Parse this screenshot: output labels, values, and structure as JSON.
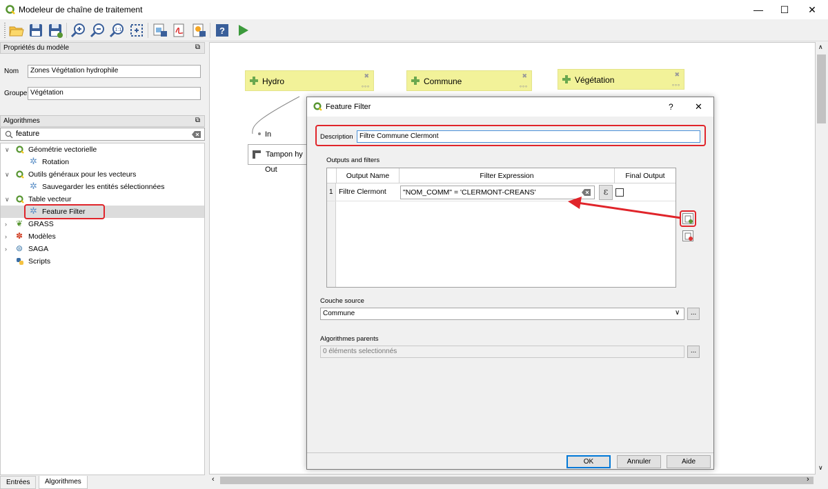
{
  "window": {
    "title": "Modeleur de chaîne de traitement",
    "minimize": "—",
    "maximize": "☐",
    "close": "✕"
  },
  "toolbar": {
    "icons": [
      "open-model-icon",
      "save-model-icon",
      "save-as-icon",
      "zoom-in-icon",
      "zoom-out-icon",
      "zoom-actual-icon",
      "zoom-full-icon",
      "export-image-icon",
      "export-pdf-icon",
      "export-svg-icon",
      "help-icon",
      "run-model-icon"
    ]
  },
  "properties": {
    "header": "Propriétés du modèle",
    "name_label": "Nom",
    "name_value": "Zones Végétation hydrophile",
    "group_label": "Groupe",
    "group_value": "Végétation"
  },
  "algorithms": {
    "header": "Algorithmes",
    "search_value": "feature",
    "tree": [
      {
        "label": "Géométrie vectorielle",
        "level": 0,
        "expanded": true
      },
      {
        "label": "Rotation",
        "level": 1
      },
      {
        "label": "Outils généraux pour les vecteurs",
        "level": 0,
        "expanded": true
      },
      {
        "label": "Sauvegarder les entités sélectionnées",
        "level": 1
      },
      {
        "label": "Table vecteur",
        "level": 0,
        "expanded": true
      },
      {
        "label": "Feature Filter",
        "level": 1,
        "selected": true
      },
      {
        "label": "GRASS",
        "level": 0
      },
      {
        "label": "Modèles",
        "level": 0
      },
      {
        "label": "SAGA",
        "level": 0
      },
      {
        "label": "Scripts",
        "level": 0
      }
    ]
  },
  "bottom_tabs": {
    "inputs": "Entrées",
    "algorithms": "Algorithmes"
  },
  "canvas": {
    "nodes": {
      "hydro": "Hydro",
      "commune": "Commune",
      "vegetation": "Végétation",
      "tampon": "Tampon hy"
    },
    "port_in": "In",
    "port_out": "Out"
  },
  "dialog": {
    "title": "Feature Filter",
    "help": "?",
    "close": "✕",
    "description_label": "Description",
    "description_value": "Filtre Commune Clermont",
    "outputs_label": "Outputs and filters",
    "col_output_name": "Output Name",
    "col_filter_expression": "Filter Expression",
    "col_final_output": "Final Output",
    "row_number": "1",
    "row_output_name": "Filtre Clermont",
    "row_expression": "\"NOM_COMM\" = 'CLERMONT-CREANS'",
    "source_label": "Couche source",
    "source_value": "Commune",
    "parents_label": "Algorithmes parents",
    "parents_value": "0 éléments selectionnés",
    "ellipsis": "...",
    "ok": "OK",
    "cancel": "Annuler",
    "help_button": "Aide"
  },
  "colors": {
    "accent_red": "#e0242a",
    "node_yellow": "#f2f299",
    "qgis_green": "#589632"
  }
}
